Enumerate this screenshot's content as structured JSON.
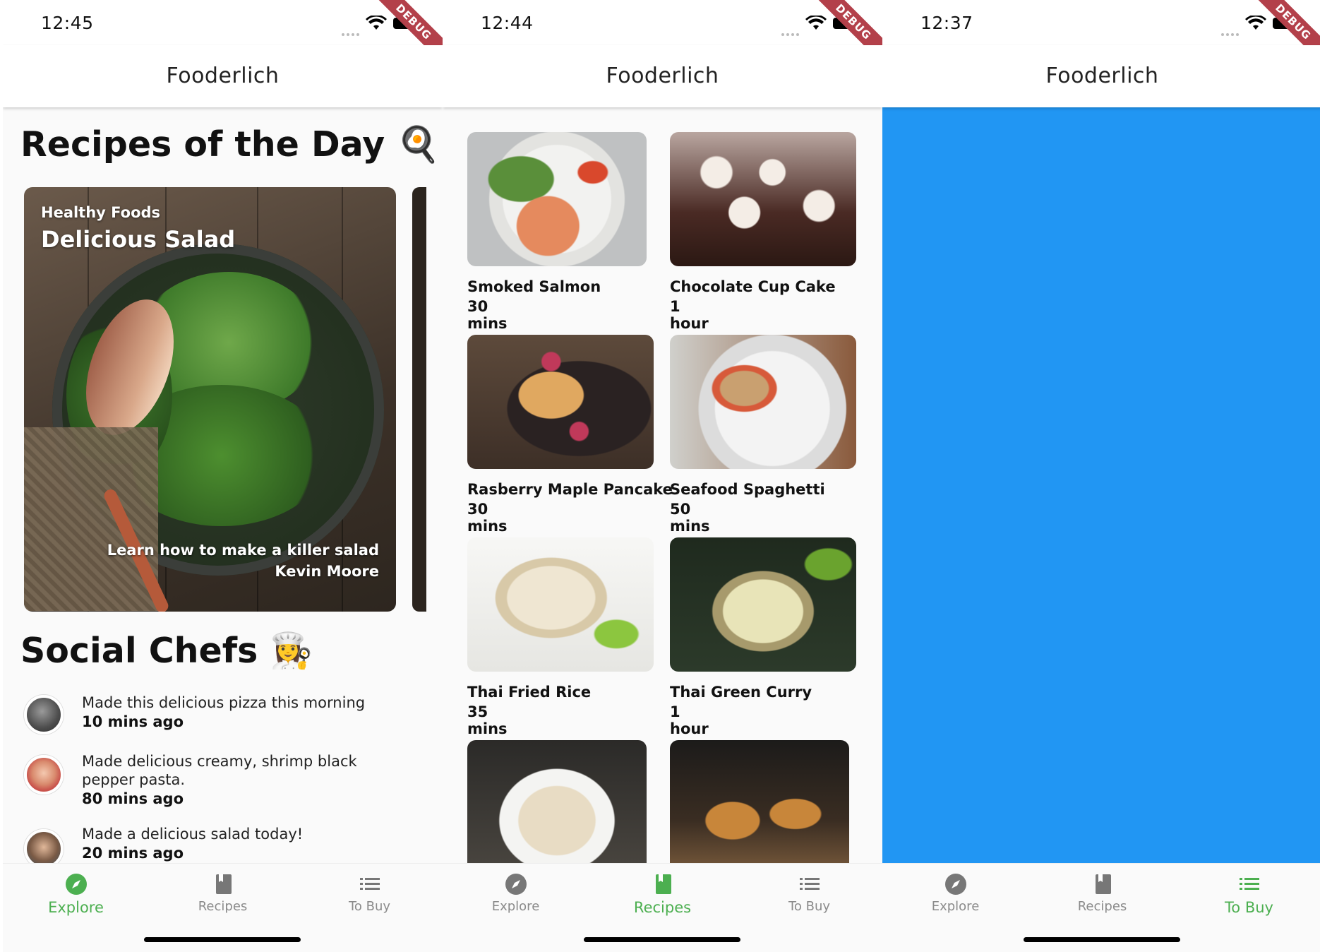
{
  "colors": {
    "accent": "#4caf50",
    "blue_panel": "#2196f3",
    "debug_ribbon": "#b3404a"
  },
  "screens": [
    {
      "time": "12:45"
    },
    {
      "time": "12:44"
    },
    {
      "time": "12:37"
    }
  ],
  "app_title": "Fooderlich",
  "debug_label": "DEBUG",
  "nav": {
    "explore": "Explore",
    "recipes": "Recipes",
    "tobuy": "To Buy",
    "explore_icon": "compass-icon",
    "recipes_icon": "book-icon",
    "tobuy_icon": "list-icon"
  },
  "explore": {
    "recipes_title": "Recipes of the Day 🍳",
    "card": {
      "overline": "Healthy Foods",
      "title": "Delicious Salad",
      "description": "Learn how to make a killer salad",
      "author": "Kevin Moore"
    },
    "social_title": "Social Chefs 👩‍🍳",
    "posts": [
      {
        "text": "Made this delicious pizza this morning",
        "time": "10 mins ago"
      },
      {
        "text": "Made delicious creamy, shrimp black pepper pasta.",
        "time": "80 mins ago"
      },
      {
        "text": "Made a delicious salad today!",
        "time": "20 mins ago"
      }
    ]
  },
  "recipes": [
    {
      "name": "Smoked Salmon",
      "duration": "30 mins"
    },
    {
      "name": "Chocolate Cup Cake",
      "duration": "1 hour"
    },
    {
      "name": "Rasberry Maple Pancake",
      "duration": "30 mins"
    },
    {
      "name": "Seafood Spaghetti",
      "duration": "50 mins"
    },
    {
      "name": "Thai Fried Rice",
      "duration": "35 mins"
    },
    {
      "name": "Thai Green Curry",
      "duration": "1 hour"
    }
  ]
}
